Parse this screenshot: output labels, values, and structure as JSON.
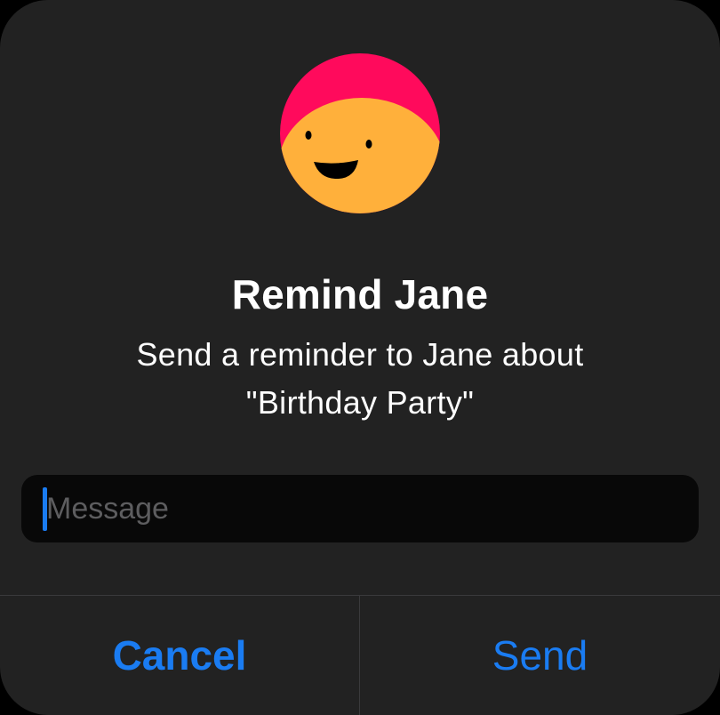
{
  "dialog": {
    "title": "Remind Jane",
    "subtitle_line1": "Send a reminder to Jane about",
    "subtitle_line2": "\"Birthday Party\""
  },
  "avatar": {
    "icon": "smiling-face-avatar",
    "hat_color": "#ff0a5c",
    "face_color": "#ffb03b"
  },
  "message": {
    "value": "",
    "placeholder": "Message"
  },
  "actions": {
    "cancel_label": "Cancel",
    "send_label": "Send"
  },
  "colors": {
    "background": "#222222",
    "accent": "#1a7cf2",
    "input_background": "#080808"
  }
}
